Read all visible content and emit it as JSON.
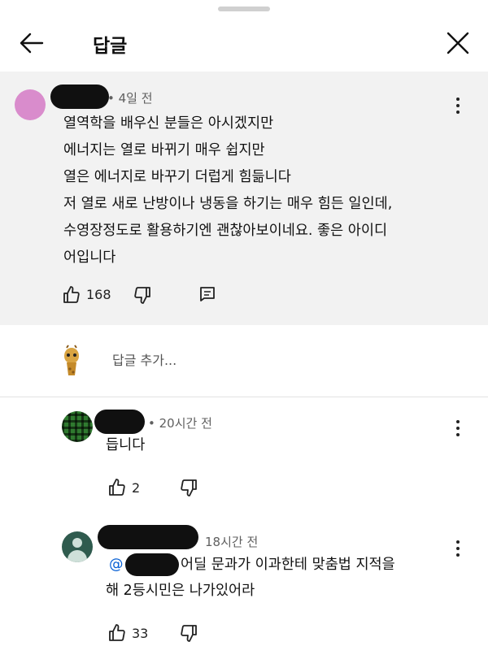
{
  "header": {
    "title": "답글"
  },
  "pinned_comment": {
    "time": "• 4일 전",
    "text": "열역학을 배우신 분들은 아시겠지만\n에너지는 열로 바뀌기 매우 쉽지만\n열은 에너지로 바꾸기 더럽게 힘듦니다\n저 열로 새로 난방이나 냉동을 하기는 매우 힘든 일인데,\n수영장정도로 활용하기엔 괜찮아보이네요. 좋은 아이디\n어입니다",
    "likes": "168"
  },
  "add_reply": {
    "placeholder": "답글 추가..."
  },
  "replies": [
    {
      "time": "• 20시간 전",
      "text": "듭니다",
      "likes": "2"
    },
    {
      "time": "18시간 전",
      "mention": "@",
      "text_line1": "어딜 문과가 이과한테 맞춤법 지적을",
      "text_line2": "해 2등시민은 나가있어라",
      "likes": "33"
    }
  ],
  "icons": [
    "back-arrow-icon",
    "close-icon",
    "more-vert-icon",
    "thumbs-up-icon",
    "thumbs-down-icon",
    "reply-comment-icon"
  ]
}
